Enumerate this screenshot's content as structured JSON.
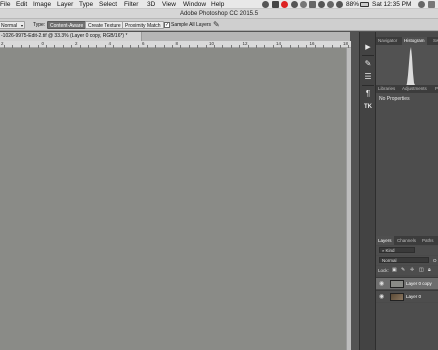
{
  "menubar": {
    "items": [
      "File",
      "Edit",
      "Image",
      "Layer",
      "Type",
      "Select",
      "Filter",
      "3D",
      "View",
      "Window",
      "Help"
    ],
    "battery": "88%",
    "clock": "Sat 12:35 PM"
  },
  "app_title": "Adobe Photoshop CC 2015.5",
  "options": {
    "mode_value": "Normal",
    "type_label": "Type:",
    "content_aware": "Content-Aware",
    "create_texture": "Create Texture",
    "proximity_match": "Proximity Match",
    "sample_all_layers": "Sample All Layers",
    "sample_all_checked": true
  },
  "document_tab": "-1026-9975-Edit-2.tif @ 33.3% (Layer 0 copy, RGB/16*) *",
  "ruler": [
    "2",
    "0",
    "2",
    "4",
    "6",
    "8",
    "10",
    "12",
    "14",
    "16",
    "18"
  ],
  "panels": {
    "top_tabs": [
      "Navigator",
      "Histogram",
      "Sw"
    ],
    "top_active": "Histogram",
    "mid_tabs": [
      "Libraries",
      "Adjustments",
      "P"
    ],
    "properties_text": "No Properties",
    "layer_tabs": [
      "Layers",
      "Channels",
      "Paths"
    ],
    "layer_tabs_active": "Layers",
    "kind_filter": "Kind",
    "blend_mode": "Normal",
    "opacity_abbrev": "O",
    "lock_label": "Lock:",
    "layers": [
      {
        "name": "Layer 0 copy",
        "selected": true
      },
      {
        "name": "Layer 0",
        "selected": false
      }
    ]
  },
  "icons": {
    "tools": [
      "play-icon",
      "brush-settings-icon",
      "sliders-icon",
      "paragraph-icon",
      "glyph-icon"
    ],
    "lock": [
      "lock-pixels-icon",
      "lock-paint-icon",
      "lock-move-icon",
      "lock-artboard-icon",
      "lock-all-icon"
    ]
  },
  "colors": {
    "canvas": "#8a8b87",
    "panel_bg": "#4a4a4a",
    "selected_layer": "#6e6e6e"
  }
}
